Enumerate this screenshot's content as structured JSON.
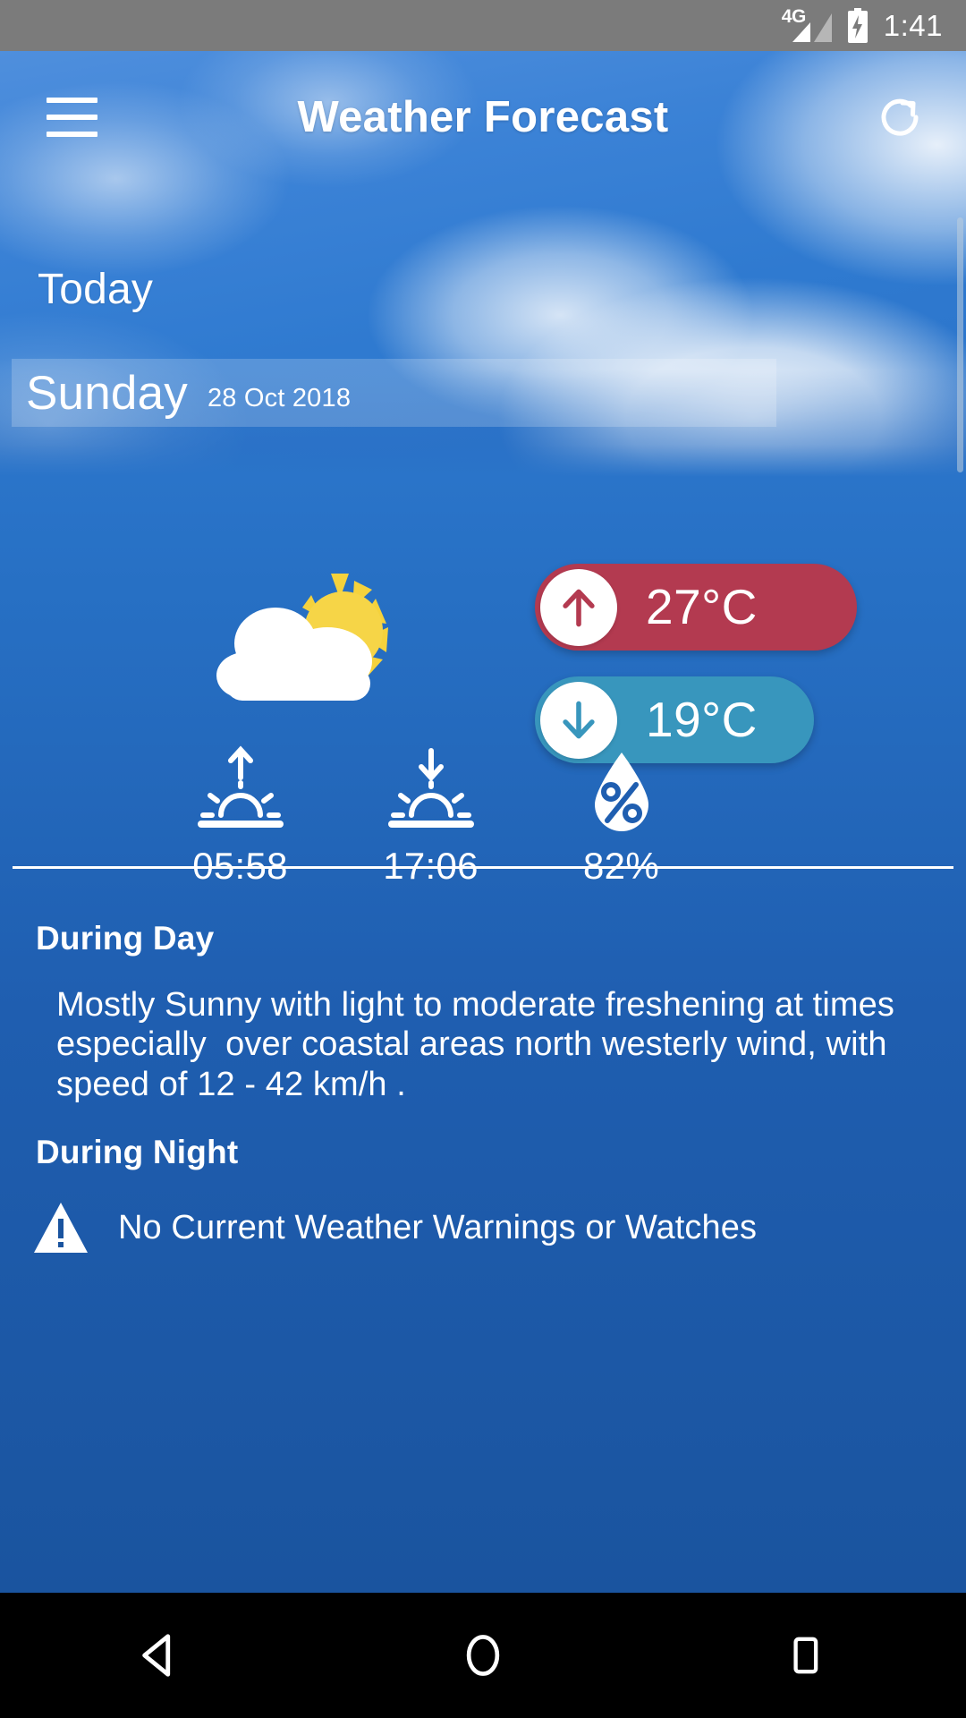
{
  "status_bar": {
    "network_label": "4G",
    "signal_icon": "signal-bars-icon",
    "battery_icon": "battery-charging-icon",
    "time": "1:41"
  },
  "app_bar": {
    "menu_icon": "hamburger-menu-icon",
    "title": "Weather Forecast",
    "refresh_icon": "refresh-icon"
  },
  "header": {
    "today_label": "Today",
    "day_name": "Sunday",
    "date": "28 Oct 2018"
  },
  "current": {
    "condition_icon": "partly-cloudy-icon",
    "high": {
      "arrow_icon": "arrow-up-icon",
      "value": "27°C",
      "color": "#b33a50"
    },
    "low": {
      "arrow_icon": "arrow-down-icon",
      "value": "19°C",
      "color": "#3896bd"
    }
  },
  "astro": [
    {
      "icon": "sunrise-icon",
      "name": "sunrise",
      "value": "05:58"
    },
    {
      "icon": "sunset-icon",
      "name": "sunset",
      "value": "17:06"
    },
    {
      "icon": "humidity-drop-icon",
      "name": "humidity",
      "value": "82%"
    }
  ],
  "forecast": {
    "day_heading": "During Day",
    "day_text": "Mostly Sunny with light to moderate freshening at times especially  over coastal areas north westerly wind, with speed of 12 - 42 km/h .",
    "night_heading": "During Night",
    "night_text": ""
  },
  "warning": {
    "icon": "warning-triangle-icon",
    "text": "No Current Weather Warnings or Watches"
  },
  "nav_bar": {
    "back_icon": "back-triangle-icon",
    "home_icon": "home-circle-icon",
    "recents_icon": "recents-square-icon"
  },
  "theme": {
    "sky_blue": "#3b82d6",
    "body_blue": "#1f5eb0",
    "status_gray": "#7b7b7b",
    "nav_black": "#000000",
    "white": "#ffffff"
  }
}
